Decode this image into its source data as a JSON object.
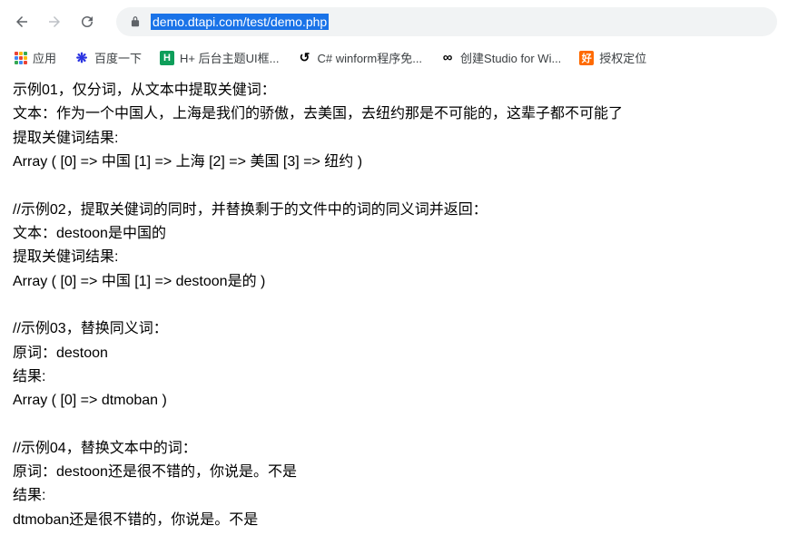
{
  "address_bar": {
    "url": "demo.dtapi.com/test/demo.php"
  },
  "bookmarks": {
    "apps": "应用",
    "items": [
      {
        "icon": "baidu",
        "label": "百度一下"
      },
      {
        "icon": "h",
        "label": "H+ 后台主题UI框..."
      },
      {
        "icon": "csharp",
        "label": "C# winform程序免..."
      },
      {
        "icon": "studio",
        "label": "创建Studio for Wi..."
      },
      {
        "icon": "hao",
        "label": "授权定位"
      }
    ]
  },
  "content": {
    "ex1": {
      "title": "示例01，仅分词，从文本中提取关健词：",
      "text": "文本：作为一个中国人，上海是我们的骄傲，去美国，去纽约那是不可能的，这辈子都不可能了",
      "result_label": "提取关健词结果:",
      "result": "Array ( [0] => 中国 [1] => 上海 [2] => 美国 [3] => 纽约 )"
    },
    "ex2": {
      "title": "//示例02，提取关健词的同时，并替换剩于的文件中的词的同义词并返回：",
      "text": "文本：destoon是中国的",
      "result_label": "提取关健词结果:",
      "result": "Array ( [0] => 中国 [1] => destoon是的 )"
    },
    "ex3": {
      "title": "//示例03，替换同义词：",
      "text": "原词：destoon",
      "result_label": "结果:",
      "result": "Array ( [0] => dtmoban )"
    },
    "ex4": {
      "title": "//示例04，替换文本中的词：",
      "text": "原词：destoon还是很不错的，你说是。不是",
      "result_label": "结果:",
      "result": "dtmoban还是很不错的，你说是。不是"
    }
  }
}
